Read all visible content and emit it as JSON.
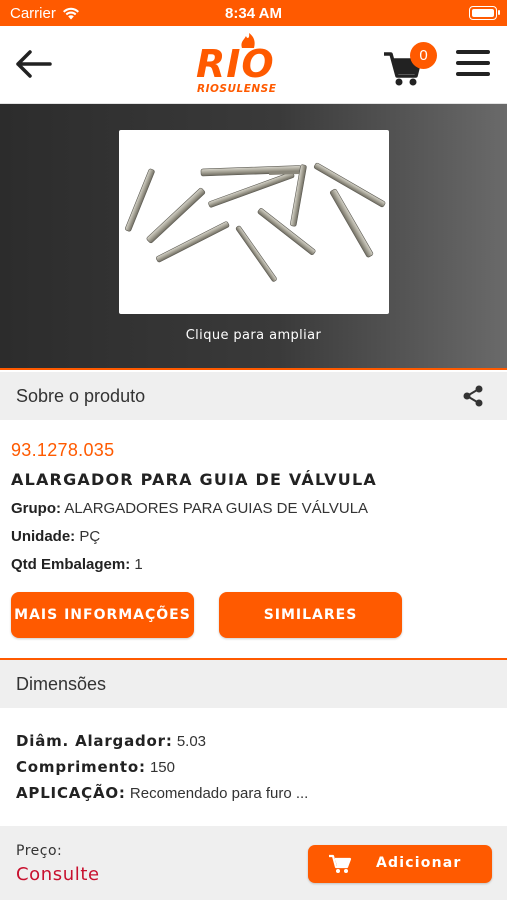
{
  "status_bar": {
    "carrier": "Carrier",
    "time": "8:34 AM"
  },
  "header": {
    "logo_text": "RIO",
    "logo_subtext": "RIOSULENSE",
    "cart_count": "0",
    "icons": [
      "back-arrow-icon",
      "cart-icon",
      "menu-icon"
    ]
  },
  "hero": {
    "zoom_label": "Clique para ampliar"
  },
  "about_section": {
    "title": "Sobre o produto",
    "icon": "share-icon"
  },
  "product": {
    "code": "93.1278.035",
    "name": "ALARGADOR PARA GUIA DE VÁLVULA",
    "group_label": "Grupo:",
    "group_value": "ALARGADORES PARA GUIAS DE VÁLVULA",
    "unit_label": "Unidade:",
    "unit_value": "PÇ",
    "pack_label": "Qtd Embalagem:",
    "pack_value": "1"
  },
  "actions": {
    "more_info_label": "MAIS INFORMAÇÕES",
    "similar_label": "SIMILARES"
  },
  "dimensions_section": {
    "title": "Dimensões"
  },
  "dimensions": [
    {
      "label": "Diâm. Alargador:",
      "value": "5.03"
    },
    {
      "label": "Comprimento:",
      "value": "150"
    },
    {
      "label": "APLICAÇÃO:",
      "value": "Recomendado para furo ..."
    }
  ],
  "footer": {
    "price_label": "Preço:",
    "price_value": "Consulte",
    "add_label": "Adicionar"
  },
  "colors": {
    "accent": "#ff5a00",
    "price": "#c8102e",
    "section_bg": "#efefef"
  }
}
